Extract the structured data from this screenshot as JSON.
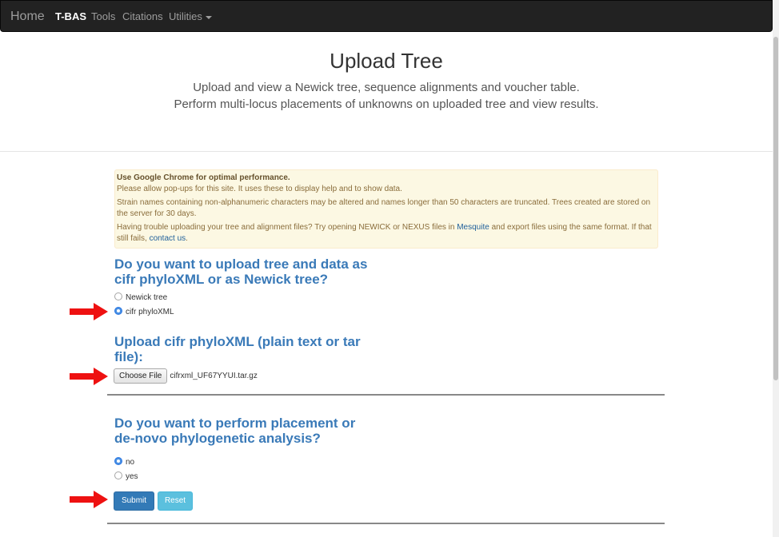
{
  "nav": {
    "brand": "Home",
    "items": [
      "T-BAS",
      "Tools",
      "Citations",
      "Utilities"
    ]
  },
  "header": {
    "title": "Upload Tree",
    "line1": "Upload and view a Newick tree, sequence alignments and voucher table.",
    "line2": "Perform multi-locus placements of unknowns on uploaded tree and view results."
  },
  "alert": {
    "bold": "Use Google Chrome for optimal performance.",
    "p1": "Please allow pop-ups for this site. It uses these to display help and to show data.",
    "p2": "Strain names containing non-alphanumeric characters may be altered and names longer than 50 characters are truncated. Trees created are stored on the server for 30 days.",
    "p3_a": "Having trouble uploading your tree and alignment files? Try opening NEWICK or NEXUS files in ",
    "p3_link1": "Mesquite",
    "p3_b": " and export files using the same format. If that still fails, ",
    "p3_link2": "contact us",
    "p3_c": "."
  },
  "q1": {
    "line1": "Do you want to upload tree and data as",
    "line2": "cifr phyloXML or as Newick tree?",
    "options": [
      "Newick tree",
      "cifr phyloXML"
    ],
    "selected": "cifr phyloXML"
  },
  "q2": {
    "line1": "Upload cifr phyloXML (plain text or tar",
    "line2": "file):",
    "button": "Choose File",
    "filename": "cifrxml_UF67YYUI.tar.gz"
  },
  "q3": {
    "line1": "Do you want to perform placement or",
    "line2": "de-novo phylogenetic analysis?",
    "options": [
      "no",
      "yes"
    ],
    "selected": "no"
  },
  "actions": {
    "submit": "Submit",
    "reset": "Reset"
  },
  "colors": {
    "navbar": "#222222",
    "heading": "#3a7ab8",
    "alert_bg": "#fcf8e3",
    "primary": "#337ab7",
    "info": "#5bc0de",
    "arrow": "#ee1111"
  }
}
